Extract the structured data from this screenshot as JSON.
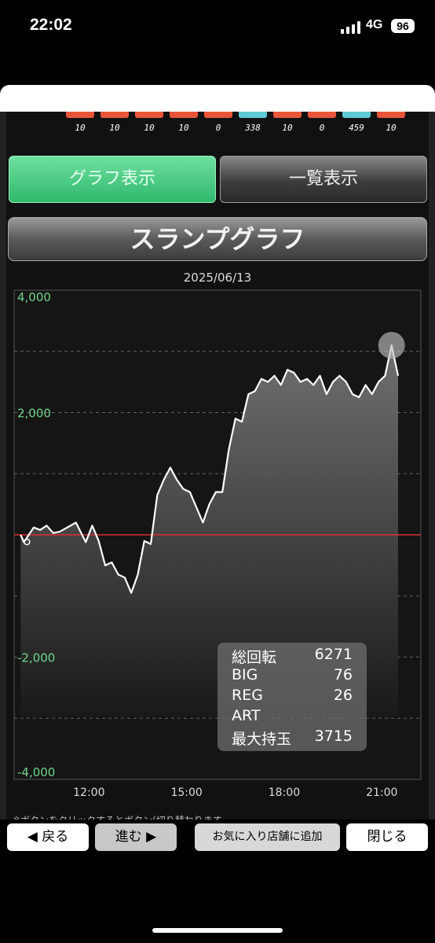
{
  "status": {
    "time": "22:02",
    "network": "4G",
    "battery": "96"
  },
  "table_values": [
    "10",
    "10",
    "10",
    "10",
    "0",
    "338",
    "10",
    "0",
    "459",
    "10"
  ],
  "table_colors": [
    "#e8553a",
    "#e8553a",
    "#e8553a",
    "#e8553a",
    "#e8553a",
    "#5ec9d6",
    "#e8553a",
    "#e8553a",
    "#5ec9d6",
    "#e8553a"
  ],
  "tabs": {
    "graph": "グラフ表示",
    "list": "一覧表示"
  },
  "header": {
    "title": "スランプグラフ"
  },
  "graph": {
    "date": "2025/06/13",
    "y_labels": [
      "4,000",
      "2,000",
      "-2,000",
      "-4,000"
    ],
    "x_labels": [
      "12:00",
      "15:00",
      "18:00",
      "21:00"
    ]
  },
  "stats": [
    {
      "label": "総回転",
      "value": "6271"
    },
    {
      "label": "BIG",
      "value": "76"
    },
    {
      "label": "REG",
      "value": "26"
    },
    {
      "label": "ART",
      "value": ""
    },
    {
      "label": "最大持玉",
      "value": "3715"
    }
  ],
  "footnote": "※ボタンをクリックするとボタン(切り替わります",
  "toolbar": {
    "back": "◀ 戻る",
    "forward": "進む ▶",
    "favorite": "お気に入り店舗に追加",
    "close": "閉じる"
  },
  "chart_data": {
    "type": "line",
    "title": "",
    "xlabel": "",
    "ylabel": "",
    "ylim": [
      -4000,
      4000
    ],
    "x_ticks": [
      "12:00",
      "15:00",
      "18:00",
      "21:00"
    ],
    "y_ticks": [
      4000,
      2000,
      -2000,
      -4000
    ],
    "zero_line_color": "#d83030",
    "grid": "dashed horizontal",
    "x": [
      9.9,
      10.0,
      10.3,
      10.5,
      10.7,
      10.9,
      11.1,
      11.6,
      11.9,
      12.1,
      12.3,
      12.5,
      12.7,
      12.9,
      13.1,
      13.3,
      13.5,
      13.7,
      13.9,
      14.1,
      14.3,
      14.5,
      14.7,
      14.9,
      15.1,
      15.3,
      15.5,
      15.7,
      15.9,
      16.1,
      16.3,
      16.5,
      16.7,
      16.9,
      17.1,
      17.3,
      17.5,
      17.7,
      17.9,
      18.1,
      18.3,
      18.5,
      18.7,
      18.9,
      19.1,
      19.3,
      19.5,
      19.7,
      19.9,
      20.1,
      20.3,
      20.5,
      20.7,
      20.9,
      21.1,
      21.3,
      21.5
    ],
    "values": [
      0,
      -120,
      120,
      80,
      150,
      30,
      50,
      200,
      -120,
      150,
      -100,
      -500,
      -450,
      -650,
      -700,
      -950,
      -650,
      -100,
      -150,
      650,
      900,
      1100,
      900,
      750,
      700,
      450,
      200,
      500,
      700,
      700,
      1400,
      1900,
      1850,
      2300,
      2350,
      2550,
      2500,
      2600,
      2450,
      2700,
      2650,
      2500,
      2550,
      2450,
      2600,
      2300,
      2500,
      2600,
      2500,
      2300,
      2250,
      2450,
      2300,
      2500,
      2600,
      3100,
      2600
    ]
  }
}
